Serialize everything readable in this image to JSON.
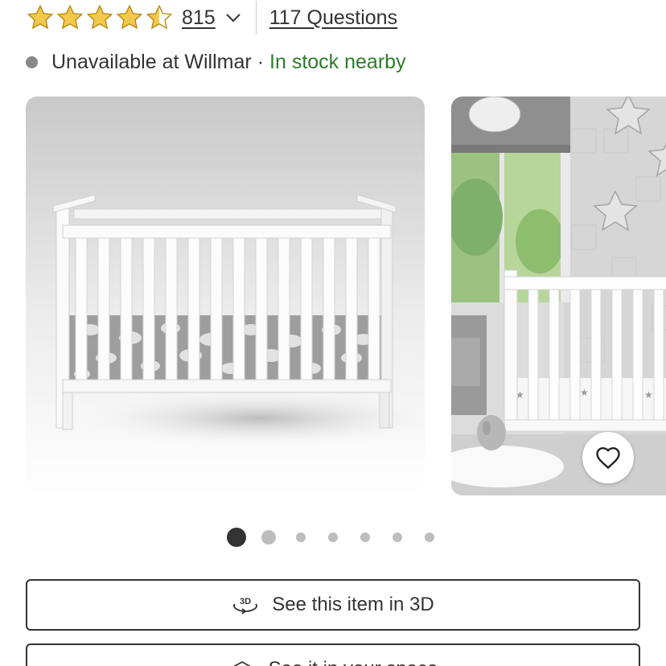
{
  "rating": {
    "value": 4.5,
    "max": 5,
    "count_label": "815",
    "star_color": "#f2c94c",
    "star_outline": "#b8860b",
    "dropdown_icon": "chevron-down-icon"
  },
  "questions": {
    "label": "117 Questions"
  },
  "availability": {
    "store_status": "Unavailable at Willmar",
    "separator": "·",
    "nearby_status": "In stock nearby",
    "nearby_color": "#2a7d2a",
    "dot_color": "#888888"
  },
  "gallery": {
    "images": [
      {
        "alt": "white crib on gray background"
      },
      {
        "alt": "white crib in nursery room"
      }
    ],
    "favorite_icon": "heart-outline-icon",
    "dot_count": 7,
    "active_index": 0
  },
  "actions": {
    "view_3d_label": "See this item in 3D",
    "view_3d_icon": "3d-rotate-icon",
    "in_space_label": "See it in your space",
    "in_space_icon": "ar-cube-icon"
  }
}
